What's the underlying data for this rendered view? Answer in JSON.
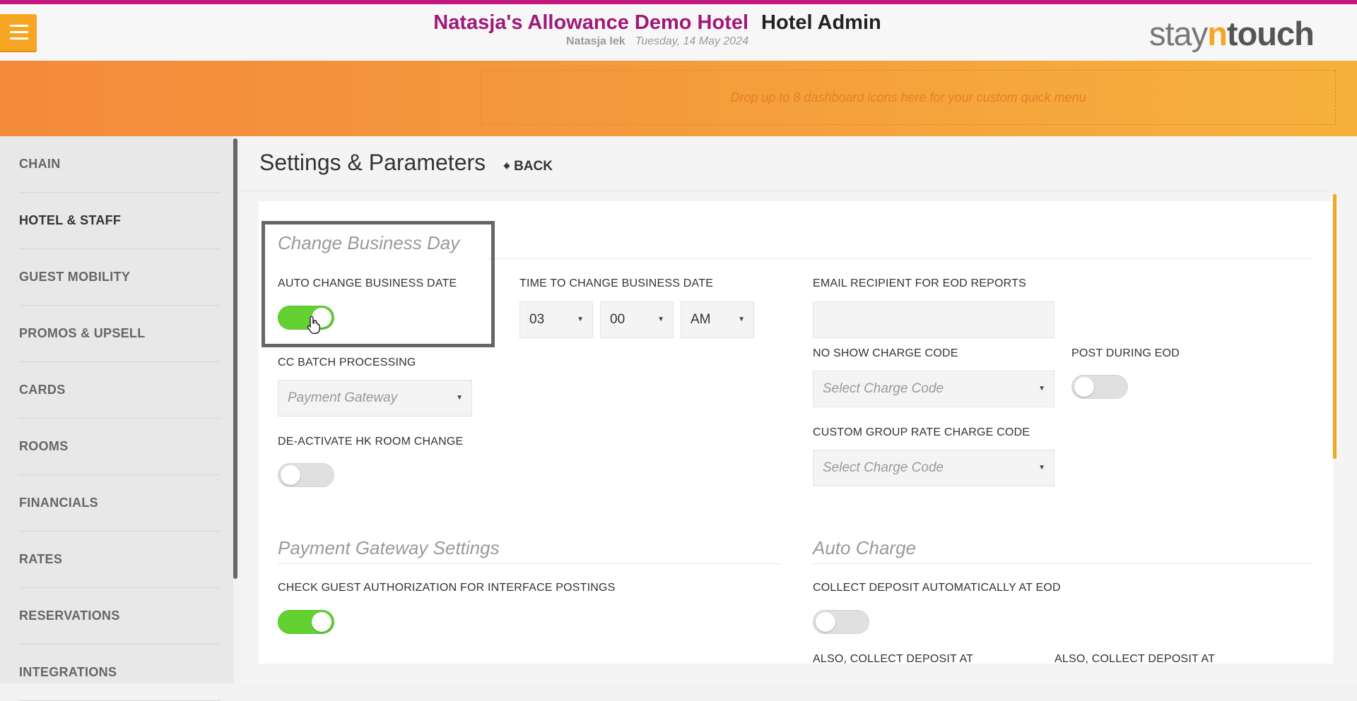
{
  "header": {
    "hotel_name": "Natasja's Allowance Demo Hotel",
    "app_title": "Hotel Admin",
    "user_name": "Natasja Iek",
    "date": "Tuesday, 14 May 2024",
    "logo": {
      "part1": "stay",
      "part2": "n",
      "part3": "touch"
    },
    "menu_icon": "hamburger-icon"
  },
  "quick_menu": {
    "placeholder": "Drop up to 8 dashboard icons here for your custom quick menu"
  },
  "sidebar": {
    "items": [
      {
        "label": "CHAIN"
      },
      {
        "label": "HOTEL & STAFF",
        "active": true
      },
      {
        "label": "GUEST MOBILITY"
      },
      {
        "label": "PROMOS & UPSELL"
      },
      {
        "label": "CARDS"
      },
      {
        "label": "ROOMS"
      },
      {
        "label": "FINANCIALS"
      },
      {
        "label": "RATES"
      },
      {
        "label": "RESERVATIONS"
      },
      {
        "label": "INTEGRATIONS"
      }
    ]
  },
  "page": {
    "title": "Settings & Parameters",
    "back_label": "BACK",
    "back_icon": "arrow-left-icon"
  },
  "change_business_day": {
    "section_title": "Change Business Day",
    "auto_change_label": "AUTO CHANGE BUSINESS DATE",
    "auto_change_on": true,
    "time_label": "TIME TO CHANGE BUSINESS DATE",
    "time_hour": "03",
    "time_minute": "00",
    "time_ampm": "AM",
    "cc_batch_label": "CC BATCH PROCESSING",
    "cc_batch_placeholder": "Payment Gateway",
    "deactivate_hk_label": "DE-ACTIVATE HK ROOM CHANGE",
    "deactivate_hk_on": false,
    "email_label": "EMAIL RECIPIENT FOR EOD REPORTS",
    "email_value": "",
    "no_show_label": "NO SHOW CHARGE CODE",
    "no_show_placeholder": "Select Charge Code",
    "post_eod_label": "POST DURING EOD",
    "post_eod_on": false,
    "custom_group_label": "CUSTOM GROUP RATE CHARGE CODE",
    "custom_group_placeholder": "Select Charge Code"
  },
  "payment_gateway": {
    "section_title": "Payment Gateway Settings",
    "check_auth_label": "CHECK GUEST AUTHORIZATION FOR INTERFACE POSTINGS",
    "check_auth_on": true
  },
  "auto_charge": {
    "section_title": "Auto Charge",
    "collect_deposit_label": "COLLECT DEPOSIT AUTOMATICALLY AT EOD",
    "collect_deposit_on": false,
    "also_collect_label_1": "ALSO, COLLECT DEPOSIT AT",
    "also_collect_label_2": "ALSO, COLLECT DEPOSIT AT"
  },
  "colors": {
    "brand_magenta": "#a0187a",
    "accent_orange": "#f6a623",
    "toggle_on": "#64d132"
  }
}
